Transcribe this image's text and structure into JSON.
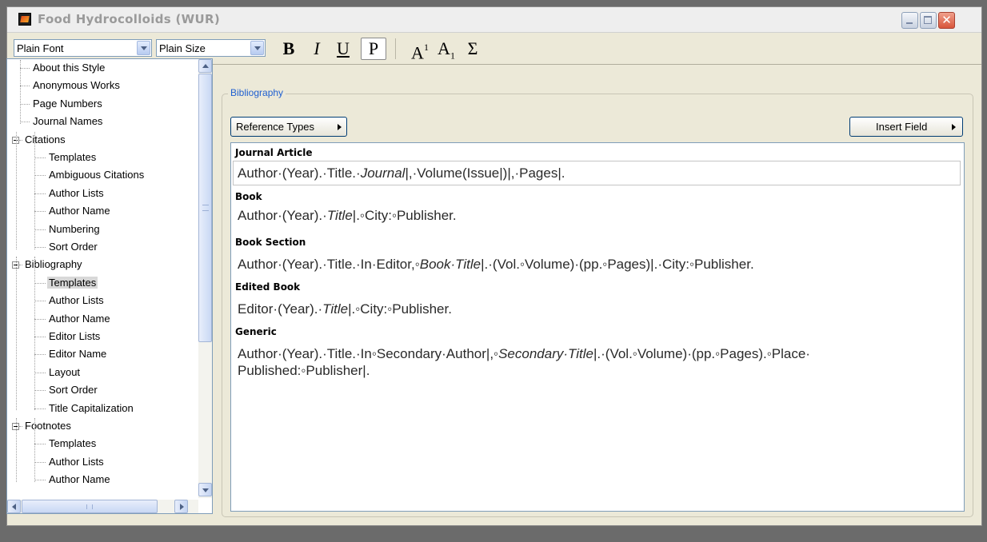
{
  "window": {
    "title": "Food Hydrocolloids (WUR)",
    "controls": {
      "close_glyph": "✕"
    }
  },
  "toolbar": {
    "font_value": "Plain Font",
    "size_value": "Plain Size",
    "bold": "B",
    "italic": "I",
    "underline": "U",
    "plain": "P",
    "superscript_base": "A",
    "superscript_exp": "1",
    "subscript_base": "A",
    "subscript_index": "1",
    "symbol": "Σ"
  },
  "tree": {
    "items": [
      {
        "label": "About this Style"
      },
      {
        "label": "Anonymous Works"
      },
      {
        "label": "Page Numbers"
      },
      {
        "label": "Journal Names"
      },
      {
        "label": "Citations"
      },
      {
        "label": "Templates"
      },
      {
        "label": "Ambiguous Citations"
      },
      {
        "label": "Author Lists"
      },
      {
        "label": "Author Name"
      },
      {
        "label": "Numbering"
      },
      {
        "label": "Sort Order"
      },
      {
        "label": "Bibliography"
      },
      {
        "label": "Templates"
      },
      {
        "label": "Author Lists"
      },
      {
        "label": "Author Name"
      },
      {
        "label": "Editor Lists"
      },
      {
        "label": "Editor Name"
      },
      {
        "label": "Layout"
      },
      {
        "label": "Sort Order"
      },
      {
        "label": "Title Capitalization"
      },
      {
        "label": "Footnotes"
      },
      {
        "label": "Templates"
      },
      {
        "label": "Author Lists"
      },
      {
        "label": "Author Name"
      }
    ]
  },
  "panel": {
    "legend": "Bibliography",
    "reference_types_label": "Reference Types",
    "insert_field_label": "Insert Field"
  },
  "templates": [
    {
      "title": "Journal Article",
      "parts": [
        "Author·(Year).·Title.·",
        "Journal",
        "|,·Volume(Issue|)|,·Pages|."
      ]
    },
    {
      "title": "Book",
      "parts": [
        "Author·(Year).·",
        "Title",
        "|.◦City:◦Publisher."
      ]
    },
    {
      "title": "Book Section",
      "parts": [
        "Author·(Year).·Title.·In·Editor,◦",
        "Book·Title",
        "|.·(Vol.◦Volume)·(pp.◦Pages)|.·City:◦Publisher."
      ]
    },
    {
      "title": "Edited Book",
      "parts": [
        "Editor·(Year).·",
        "Title",
        "|.◦City:◦Publisher."
      ]
    },
    {
      "title": "Generic",
      "parts": [
        "Author·(Year).·Title.·In◦Secondary·Author|,◦",
        "Secondary·Title",
        "|.·(Vol.◦Volume)·(pp.◦Pages).◦Place·"
      ],
      "line2": "Published:◦Publisher|."
    }
  ]
}
